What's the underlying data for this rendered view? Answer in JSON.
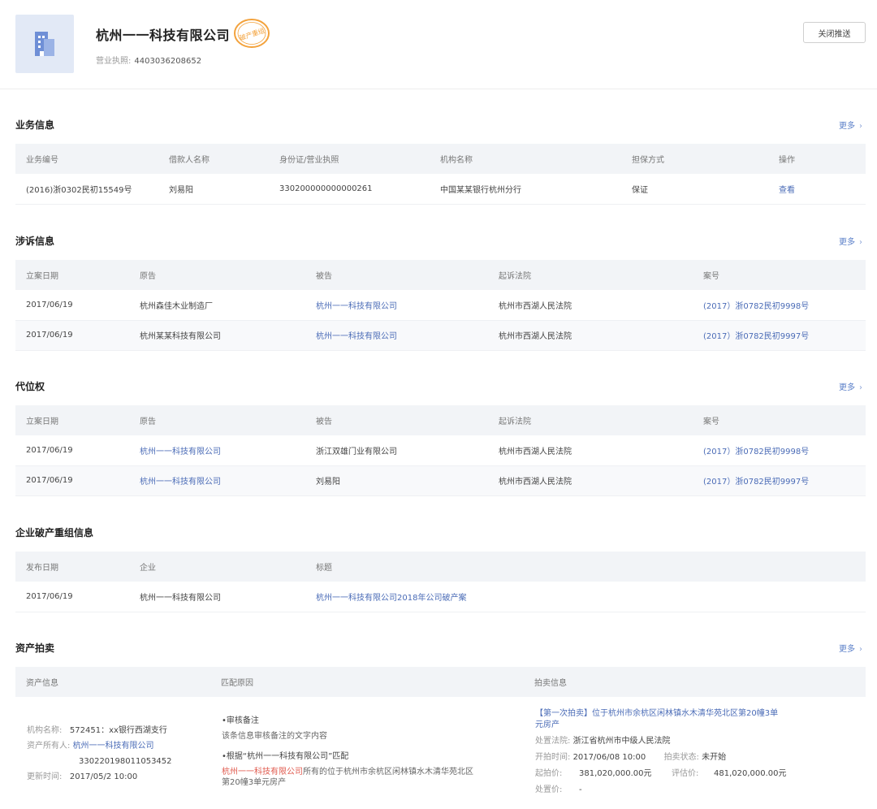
{
  "header": {
    "company_name": "杭州一一科技有限公司",
    "stamp_text": "破产重组",
    "license_label": "营业执照:",
    "license_value": "4403036208652",
    "close_button": "关闭推送"
  },
  "more_label": "更多",
  "business": {
    "title": "业务信息",
    "columns": [
      "业务编号",
      "借款人名称",
      "身份证/营业执照",
      "机构名称",
      "担保方式",
      "操作"
    ],
    "rows": [
      {
        "no": "(2016)浙0302民初15549号",
        "borrower": "刘易阳",
        "id": "330200000000000261",
        "org": "中国某某银行杭州分行",
        "guarantee": "保证",
        "action": "查看"
      }
    ]
  },
  "litigation": {
    "title": "涉诉信息",
    "columns": [
      "立案日期",
      "原告",
      "被告",
      "起诉法院",
      "案号"
    ],
    "rows": [
      {
        "date": "2017/06/19",
        "plaintiff": "杭州森佳木业制造厂",
        "defendant": "杭州一一科技有限公司",
        "court": "杭州市西湖人民法院",
        "case": "(2017）浙0782民初9998号"
      },
      {
        "date": "2017/06/19",
        "plaintiff": "杭州某某科技有限公司",
        "defendant": "杭州一一科技有限公司",
        "court": "杭州市西湖人民法院",
        "case": "(2017）浙0782民初9997号"
      }
    ]
  },
  "subrogation": {
    "title": "代位权",
    "columns": [
      "立案日期",
      "原告",
      "被告",
      "起诉法院",
      "案号"
    ],
    "rows": [
      {
        "date": "2017/06/19",
        "plaintiff": "杭州一一科技有限公司",
        "defendant": "浙江双雄门业有限公司",
        "court": "杭州市西湖人民法院",
        "case": "(2017）浙0782民初9998号"
      },
      {
        "date": "2017/06/19",
        "plaintiff": "杭州一一科技有限公司",
        "defendant": "刘易阳",
        "court": "杭州市西湖人民法院",
        "case": "(2017）浙0782民初9997号"
      }
    ]
  },
  "bankruptcy": {
    "title": "企业破产重组信息",
    "columns": [
      "发布日期",
      "企业",
      "标题"
    ],
    "rows": [
      {
        "date": "2017/06/19",
        "company": "杭州一一科技有限公司",
        "headline": "杭州一一科技有限公司2018年公司破产案"
      }
    ]
  },
  "auction": {
    "title": "资产拍卖",
    "columns": [
      "资产信息",
      "匹配原因",
      "拍卖信息"
    ],
    "asset": {
      "org_label": "机构名称:",
      "org_value": "572451：xx银行西湖支行",
      "owner_label": "资产所有人:",
      "owner_value": "杭州一一科技有限公司",
      "owner_id": "330220198011053452",
      "updated_label": "更新时间:",
      "updated_value": "2017/05/2 10:00"
    },
    "reason": {
      "r1_title": "•审核备注",
      "r1_text": "该条信息审核备注的文字内容",
      "r2_title": "•根据“杭州一一科技有限公司”匹配",
      "r2_highlight": "杭州一一科技有限公司",
      "r2_text_a": "所有的位于杭州市余杭区闲林镇水木清华苑北区",
      "r2_text_b": "第20幢3单元房产"
    },
    "info": {
      "headline_a": "【第一次拍卖】位于杭州市余杭区闲林镇水木清华苑北区第20幢3单",
      "headline_b": "元房产",
      "court_label": "处置法院:",
      "court_value": "浙江省杭州市中级人民法院",
      "start_label": "开拍时间:",
      "start_value": "2017/06/08 10:00",
      "status_label": "拍卖状态:",
      "status_value": "未开始",
      "starting_label": "起拍价:",
      "starting_value": "381,020,000.00元",
      "eval_label": "评估价:",
      "eval_value": "481,020,000.00元",
      "final_label": "处置价:",
      "final_value": "-"
    }
  }
}
